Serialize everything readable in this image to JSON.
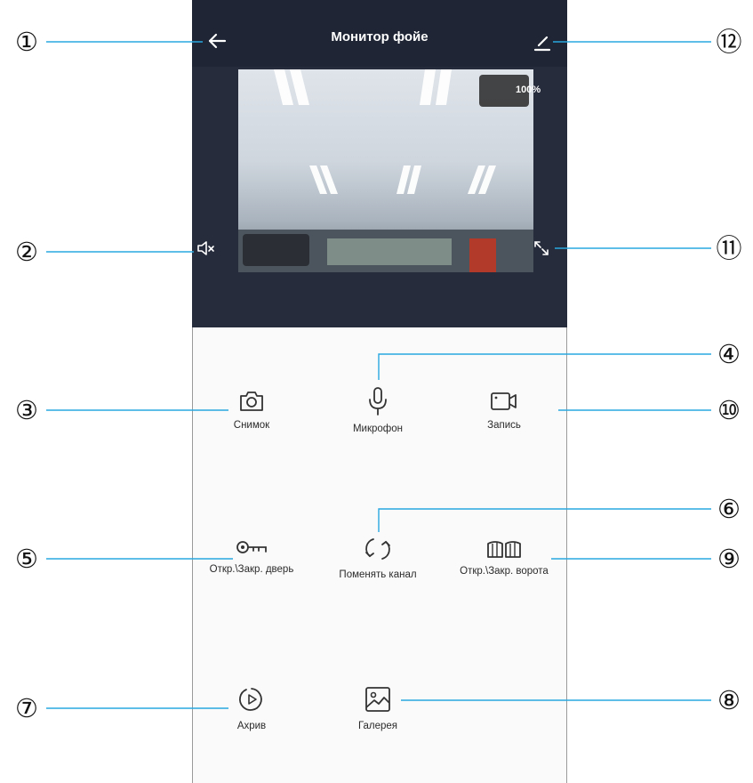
{
  "header": {
    "title": "Монитор фойе",
    "back_icon": "arrow-left-icon",
    "edit_icon": "pencil-icon"
  },
  "video": {
    "zoom": "100%",
    "mute_icon": "speaker-muted-icon",
    "fullscreen_icon": "fullscreen-icon"
  },
  "controls": [
    {
      "label": "Снимок",
      "icon": "camera-icon"
    },
    {
      "label": "Микрофон",
      "icon": "microphone-icon"
    },
    {
      "label": "Запись",
      "icon": "video-record-icon"
    },
    {
      "label": "Откр.\\Закр. дверь",
      "icon": "key-icon"
    },
    {
      "label": "Поменять канал",
      "icon": "switch-channel-icon"
    },
    {
      "label": "Откр.\\Закр. ворота",
      "icon": "gate-icon"
    },
    {
      "label": "Ахрив",
      "icon": "playback-icon"
    },
    {
      "label": "Галерея",
      "icon": "gallery-icon"
    }
  ],
  "callouts": [
    "①",
    "②",
    "③",
    "④",
    "⑤",
    "⑥",
    "⑦",
    "⑧",
    "⑨",
    "⑩",
    "⑪",
    "⑫"
  ],
  "colors": {
    "header_bg": "#1f2534",
    "video_bg": "#262c3b",
    "callout_line": "#29a8e0",
    "icon": "#333333"
  }
}
